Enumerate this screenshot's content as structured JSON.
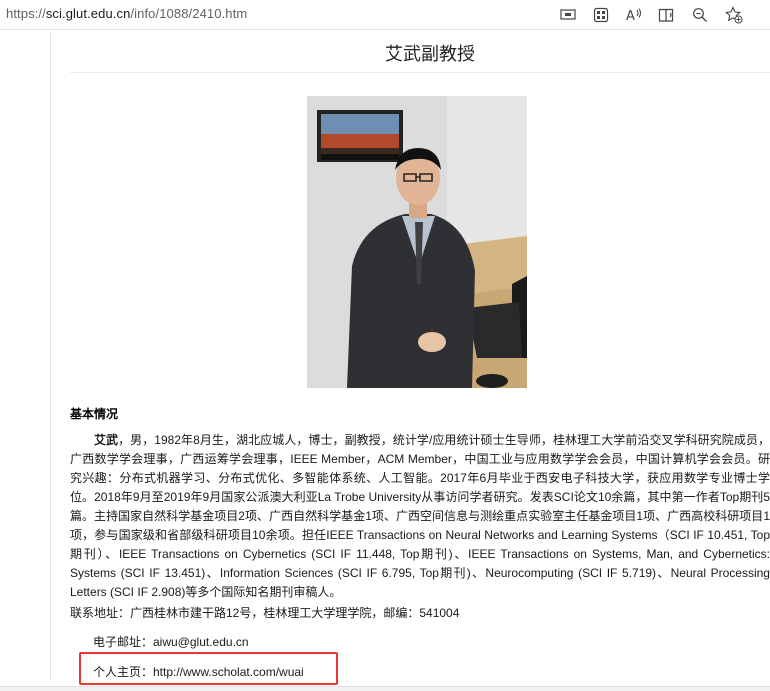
{
  "browser": {
    "url_scheme": "https://",
    "url_host": "sci.glut.edu.cn",
    "url_path": "/info/1088/2410.htm",
    "toolbar_icons": [
      "screen-cast-icon",
      "apps-icon",
      "read-aloud-icon",
      "immersive-reader-icon",
      "zoom-icon",
      "favorites-icon"
    ]
  },
  "page": {
    "title": "艾武副教授",
    "section_heading": "基本情况",
    "bio_name": "艾武",
    "bio_text": "，男，1982年8月生，湖北应城人，博士，副教授，统计学/应用统计硕士生导师，桂林理工大学前沿交叉学科研究院成员，广西数学学会理事，广西运筹学会理事，IEEE Member，ACM Member，中国工业与应用数学学会会员，中国计算机学会会员。研究兴趣：分布式机器学习、分布式优化、多智能体系统、人工智能。2017年6月毕业于西安电子科技大学，获应用数学专业博士学位。2018年9月至2019年9月国家公派澳大利亚La Trobe University从事访问学者研究。发表SCI论文10余篇，其中第一作者Top期刊5篇。主持国家自然科学基金项目2项、广西自然科学基金1项、广西空间信息与测绘重点实验室主任基金项目1项、广西高校科研项目1项，参与国家级和省部级科研项目10余项。担任IEEE Transactions on Neural Networks and Learning Systems（SCI IF 10.451, Top期刊）、IEEE Transactions on Cybernetics (SCI IF 11.448, Top期刊)、IEEE Transactions on Systems, Man, and Cybernetics: Systems (SCI IF 13.451)、Information Sciences (SCI IF 6.795, Top期刊)、Neurocomputing (SCI IF 5.719)、Neural Processing Letters (SCI IF 2.908)等多个国际知名期刊审稿人。",
    "contact_address": "联系地址：广西桂林市建干路12号，桂林理工大学理学院，邮编：541004",
    "email": "电子邮址：aiwu@glut.edu.cn",
    "homepage": "个人主页：http://www.scholat.com/wuai"
  },
  "colors": {
    "highlight_border": "#e53935",
    "url_gray": "#5f6368"
  }
}
